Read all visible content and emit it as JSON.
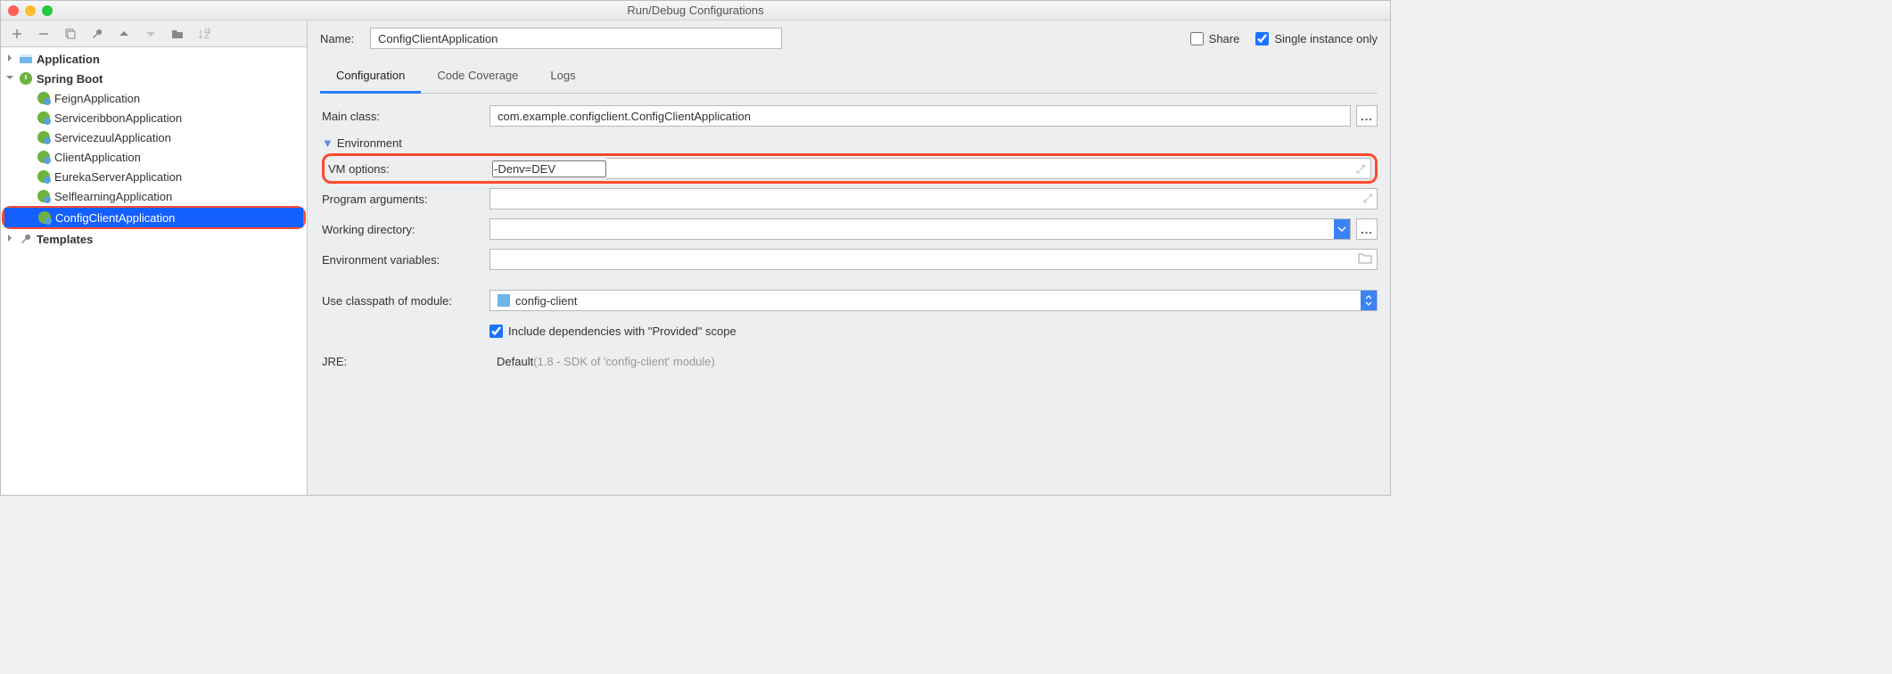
{
  "window": {
    "title": "Run/Debug Configurations"
  },
  "header": {
    "name_label": "Name:",
    "name_value": "ConfigClientApplication",
    "share_label": "Share",
    "single_label": "Single instance only"
  },
  "tabs": {
    "configuration": "Configuration",
    "coverage": "Code Coverage",
    "logs": "Logs"
  },
  "tree": {
    "application": "Application",
    "springboot": "Spring Boot",
    "items": [
      "FeignApplication",
      "ServiceribbonApplication",
      "ServicezuulApplication",
      "ClientApplication",
      "EurekaServerApplication",
      "SelflearningApplication",
      "ConfigClientApplication"
    ],
    "templates": "Templates"
  },
  "form": {
    "main_class_label": "Main class:",
    "main_class_value": "com.example.configclient.ConfigClientApplication",
    "env_section": "Environment",
    "vm_label": "VM options:",
    "vm_value": "-Denv=DEV",
    "prog_args_label": "Program arguments:",
    "workdir_label": "Working directory:",
    "envvars_label": "Environment variables:",
    "classpath_label": "Use classpath of module:",
    "classpath_value": "config-client",
    "include_provided_label": "Include dependencies with \"Provided\" scope",
    "jre_label": "JRE:",
    "jre_value_prefix": "Default ",
    "jre_value_gray": "(1.8 - SDK of 'config-client' module)"
  }
}
